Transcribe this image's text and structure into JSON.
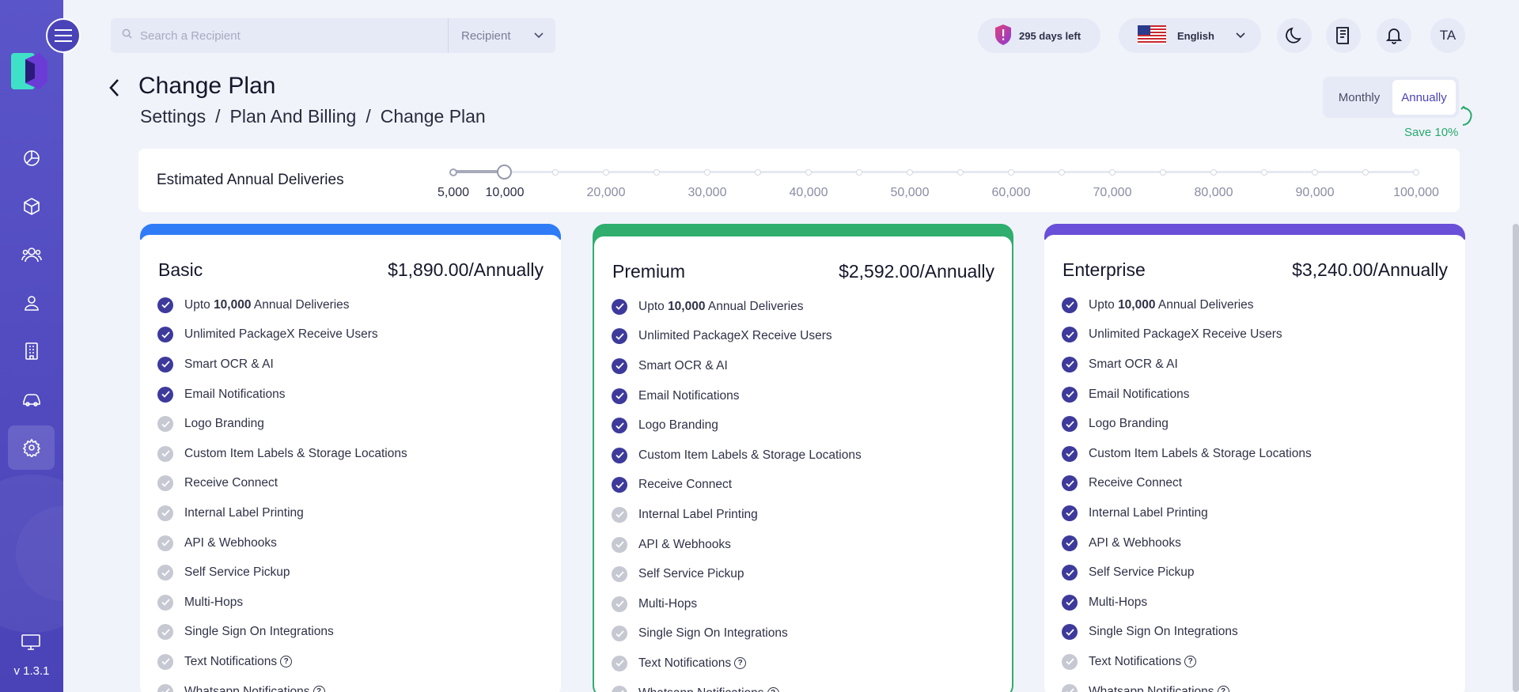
{
  "app": {
    "version": "v 1.3.1"
  },
  "sidebar": {
    "items": [
      {
        "icon": "dashboard-icon"
      },
      {
        "icon": "package-icon"
      },
      {
        "icon": "users-group-icon"
      },
      {
        "icon": "user-icon"
      },
      {
        "icon": "building-icon"
      },
      {
        "icon": "car-icon"
      },
      {
        "icon": "gear-icon",
        "active": true
      }
    ]
  },
  "header": {
    "search_placeholder": "Search a Recipient",
    "search_type": "Recipient",
    "trial": "295 days left",
    "language": "English",
    "avatar": "TA"
  },
  "page": {
    "title": "Change Plan",
    "breadcrumb": [
      "Settings",
      "Plan And Billing",
      "Change Plan"
    ],
    "billing_toggle": {
      "monthly": "Monthly",
      "annually": "Annually",
      "selected": "Annually"
    },
    "save_note": "Save 10%"
  },
  "deliveries": {
    "label": "Estimated Annual Deliveries",
    "min_label": "5,000",
    "selected_label": "10,000",
    "ticks": [
      "20,000",
      "30,000",
      "40,000",
      "50,000",
      "60,000",
      "70,000",
      "80,000",
      "90,000",
      "100,000"
    ]
  },
  "plans": [
    {
      "name": "Basic",
      "price": "$1,890.00/Annually",
      "color": "#2f7cf6",
      "features": [
        {
          "pre": "Upto ",
          "bold": "10,000",
          "post": " Annual Deliveries",
          "on": true
        },
        {
          "text": "Unlimited PackageX Receive Users",
          "on": true
        },
        {
          "text": "Smart OCR & AI",
          "on": true
        },
        {
          "text": "Email Notifications",
          "on": true
        },
        {
          "text": "Logo Branding",
          "on": false
        },
        {
          "text": "Custom Item Labels & Storage Locations",
          "on": false
        },
        {
          "text": "Receive Connect",
          "on": false
        },
        {
          "text": "Internal Label Printing",
          "on": false
        },
        {
          "text": "API & Webhooks",
          "on": false
        },
        {
          "text": "Self Service Pickup",
          "on": false
        },
        {
          "text": "Multi-Hops",
          "on": false
        },
        {
          "text": "Single Sign On Integrations",
          "on": false
        },
        {
          "text": "Text Notifications",
          "on": false,
          "help": true
        },
        {
          "text": "Whatsapp Notifications",
          "on": false,
          "help": true
        }
      ]
    },
    {
      "name": "Premium",
      "price": "$2,592.00/Annually",
      "color": "#2fae6e",
      "features": [
        {
          "pre": "Upto ",
          "bold": "10,000",
          "post": " Annual Deliveries",
          "on": true
        },
        {
          "text": "Unlimited PackageX Receive Users",
          "on": true
        },
        {
          "text": "Smart OCR & AI",
          "on": true
        },
        {
          "text": "Email Notifications",
          "on": true
        },
        {
          "text": "Logo Branding",
          "on": true
        },
        {
          "text": "Custom Item Labels & Storage Locations",
          "on": true
        },
        {
          "text": "Receive Connect",
          "on": true
        },
        {
          "text": "Internal Label Printing",
          "on": false
        },
        {
          "text": "API & Webhooks",
          "on": false
        },
        {
          "text": "Self Service Pickup",
          "on": false
        },
        {
          "text": "Multi-Hops",
          "on": false
        },
        {
          "text": "Single Sign On Integrations",
          "on": false
        },
        {
          "text": "Text Notifications",
          "on": false,
          "help": true
        },
        {
          "text": "Whatsapp Notifications",
          "on": false,
          "help": true
        }
      ]
    },
    {
      "name": "Enterprise",
      "price": "$3,240.00/Annually",
      "color": "#6a4fd8",
      "features": [
        {
          "pre": "Upto ",
          "bold": "10,000",
          "post": " Annual Deliveries",
          "on": true
        },
        {
          "text": "Unlimited PackageX Receive Users",
          "on": true
        },
        {
          "text": "Smart OCR & AI",
          "on": true
        },
        {
          "text": "Email Notifications",
          "on": true
        },
        {
          "text": "Logo Branding",
          "on": true
        },
        {
          "text": "Custom Item Labels & Storage Locations",
          "on": true
        },
        {
          "text": "Receive Connect",
          "on": true
        },
        {
          "text": "Internal Label Printing",
          "on": true
        },
        {
          "text": "API & Webhooks",
          "on": true
        },
        {
          "text": "Self Service Pickup",
          "on": true
        },
        {
          "text": "Multi-Hops",
          "on": true
        },
        {
          "text": "Single Sign On Integrations",
          "on": true
        },
        {
          "text": "Text Notifications",
          "on": false,
          "help": true
        },
        {
          "text": "Whatsapp Notifications",
          "on": false,
          "help": true
        }
      ]
    }
  ]
}
